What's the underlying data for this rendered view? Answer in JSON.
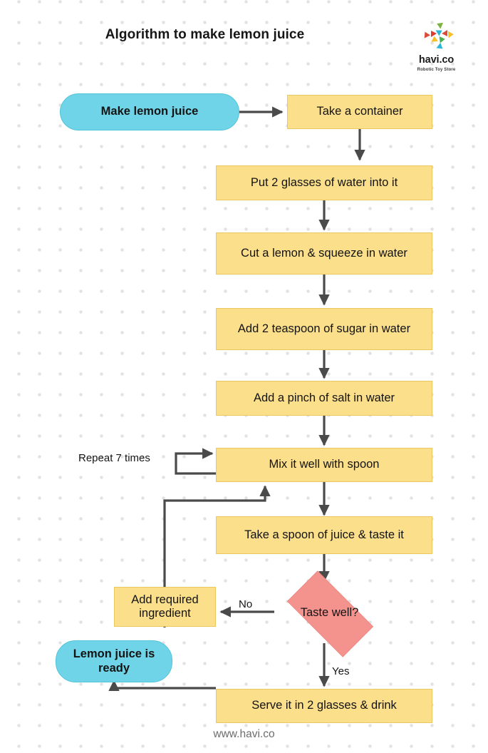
{
  "page": {
    "title": "Algorithm to make lemon juice",
    "footer": "www.havi.co",
    "background_color": "#ffffff",
    "dot_color": "#e2e2e5"
  },
  "logo": {
    "wordmark": "havi.co",
    "tagline": "Robotic Toy Store",
    "mark_name": "triangle-burst-logo",
    "colors": [
      "#7cb342",
      "#e03b2f",
      "#29b6d8",
      "#f6c026",
      "#4caf50",
      "#d94c3d"
    ]
  },
  "flowchart": {
    "type": "flowchart",
    "colors": {
      "process_fill": "#fbdf8b",
      "process_border": "#e9c95f",
      "terminal_fill": "#6fd4e8",
      "terminal_border": "#53c4da",
      "decision_fill": "#f4938e",
      "decision_border": "#eb827d",
      "edge": "#4a4a4a"
    },
    "nodes": [
      {
        "id": "start",
        "label": "Make lemon juice",
        "shape": "terminal"
      },
      {
        "id": "container",
        "label": "Take a container",
        "shape": "process"
      },
      {
        "id": "water",
        "label": "Put 2 glasses of water into it",
        "shape": "process"
      },
      {
        "id": "lemon",
        "label": "Cut a lemon & squeeze in water",
        "shape": "process"
      },
      {
        "id": "sugar",
        "label": "Add 2 teaspoon of sugar in water",
        "shape": "process"
      },
      {
        "id": "salt",
        "label": "Add a pinch of salt in water",
        "shape": "process"
      },
      {
        "id": "mix",
        "label": "Mix it well with spoon",
        "shape": "process"
      },
      {
        "id": "taste",
        "label": "Take a spoon of juice & taste it",
        "shape": "process"
      },
      {
        "id": "decision",
        "label": "Taste well?",
        "shape": "decision"
      },
      {
        "id": "addreq",
        "label": "Add required ingredient",
        "shape": "process"
      },
      {
        "id": "serve",
        "label": "Serve it in 2 glasses & drink",
        "shape": "process"
      },
      {
        "id": "end",
        "label": "Lemon juice is ready",
        "shape": "terminal"
      }
    ],
    "edge_labels": {
      "repeat": "Repeat 7 times",
      "no": "No",
      "yes": "Yes"
    }
  }
}
